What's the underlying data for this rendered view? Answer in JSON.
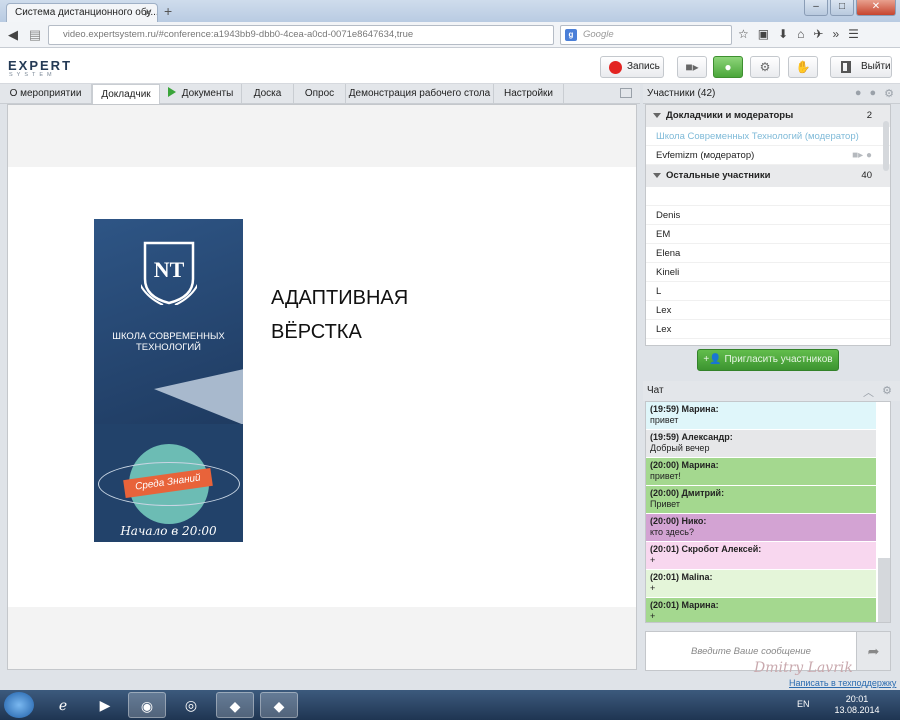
{
  "browser": {
    "tab_title": "Система дистанционного обу...",
    "url": "video.expertsystem.ru/#conference:a1943bb9-dbb0-4cea-a0cd-0071e8647634,true",
    "search_placeholder": "Google"
  },
  "header": {
    "logo": "EXPERT",
    "logo_sub": "SYSTEM",
    "record_label": "Запись",
    "exit_label": "Выйти"
  },
  "tabs": [
    {
      "label": "О мероприятии"
    },
    {
      "label": "Докладчик"
    },
    {
      "label": "Документы"
    },
    {
      "label": "Доска"
    },
    {
      "label": "Опрос"
    },
    {
      "label": "Демонстрация рабочего стола"
    },
    {
      "label": "Настройки"
    }
  ],
  "slide": {
    "school_name_line1": "ШКОЛА СОВРЕМЕННЫХ",
    "school_name_line2": "ТЕХНОЛОГИЙ",
    "badge_sreda": "Среда Знаний",
    "start_time": "Начало в 20:00",
    "title_line1": "АДАПТИВНАЯ",
    "title_line2": "ВЁРСТКА"
  },
  "participants": {
    "title": "Участники (42)",
    "speakers_group": {
      "label": "Докладчики и модераторы",
      "count": "2"
    },
    "speakers": [
      {
        "name": "Школа Современных Технологий (модератор)"
      },
      {
        "name": "Evfemizm (модератор)"
      }
    ],
    "others_group": {
      "label": "Остальные участники",
      "count": "40"
    },
    "others": [
      {
        "name": ""
      },
      {
        "name": "Denis"
      },
      {
        "name": "EM"
      },
      {
        "name": "Elena"
      },
      {
        "name": "Kineli"
      },
      {
        "name": "L"
      },
      {
        "name": "Lex"
      },
      {
        "name": "Lex"
      }
    ],
    "invite_label": "Пригласить участников"
  },
  "chat": {
    "title": "Чат",
    "messages": [
      {
        "header": "(19:59) Марина:",
        "text": "привет",
        "color": "#dff6fa"
      },
      {
        "header": "(19:59) Александр:",
        "text": "Добрый вечер",
        "color": "#e6e7e9"
      },
      {
        "header": "(20:00) Марина:",
        "text": "привет!",
        "color": "#a4d88f"
      },
      {
        "header": "(20:00) Дмитрий:",
        "text": "Привет",
        "color": "#a4d88f"
      },
      {
        "header": "(20:00) Нико:",
        "text": "кто здесь?",
        "color": "#d3a3d3"
      },
      {
        "header": "(20:01) Скробот Алексей:",
        "text": "+",
        "color": "#f8d7ef"
      },
      {
        "header": "(20:01) Malina:",
        "text": "+",
        "color": "#e4f5d9"
      },
      {
        "header": "(20:01) Марина:",
        "text": "+",
        "color": "#a4d88f"
      }
    ],
    "input_placeholder": "Введите Ваше сообщение",
    "support_link": "Написать в техподдержку",
    "watermark": "Dmitry Lavrik"
  },
  "taskbar": {
    "lang": "EN",
    "time": "20:01",
    "date": "13.08.2014"
  },
  "colors": {
    "record": "#e32422",
    "mic_active": "#4aa63a",
    "invite": "#3c9430",
    "link": "#2b6cb0"
  }
}
